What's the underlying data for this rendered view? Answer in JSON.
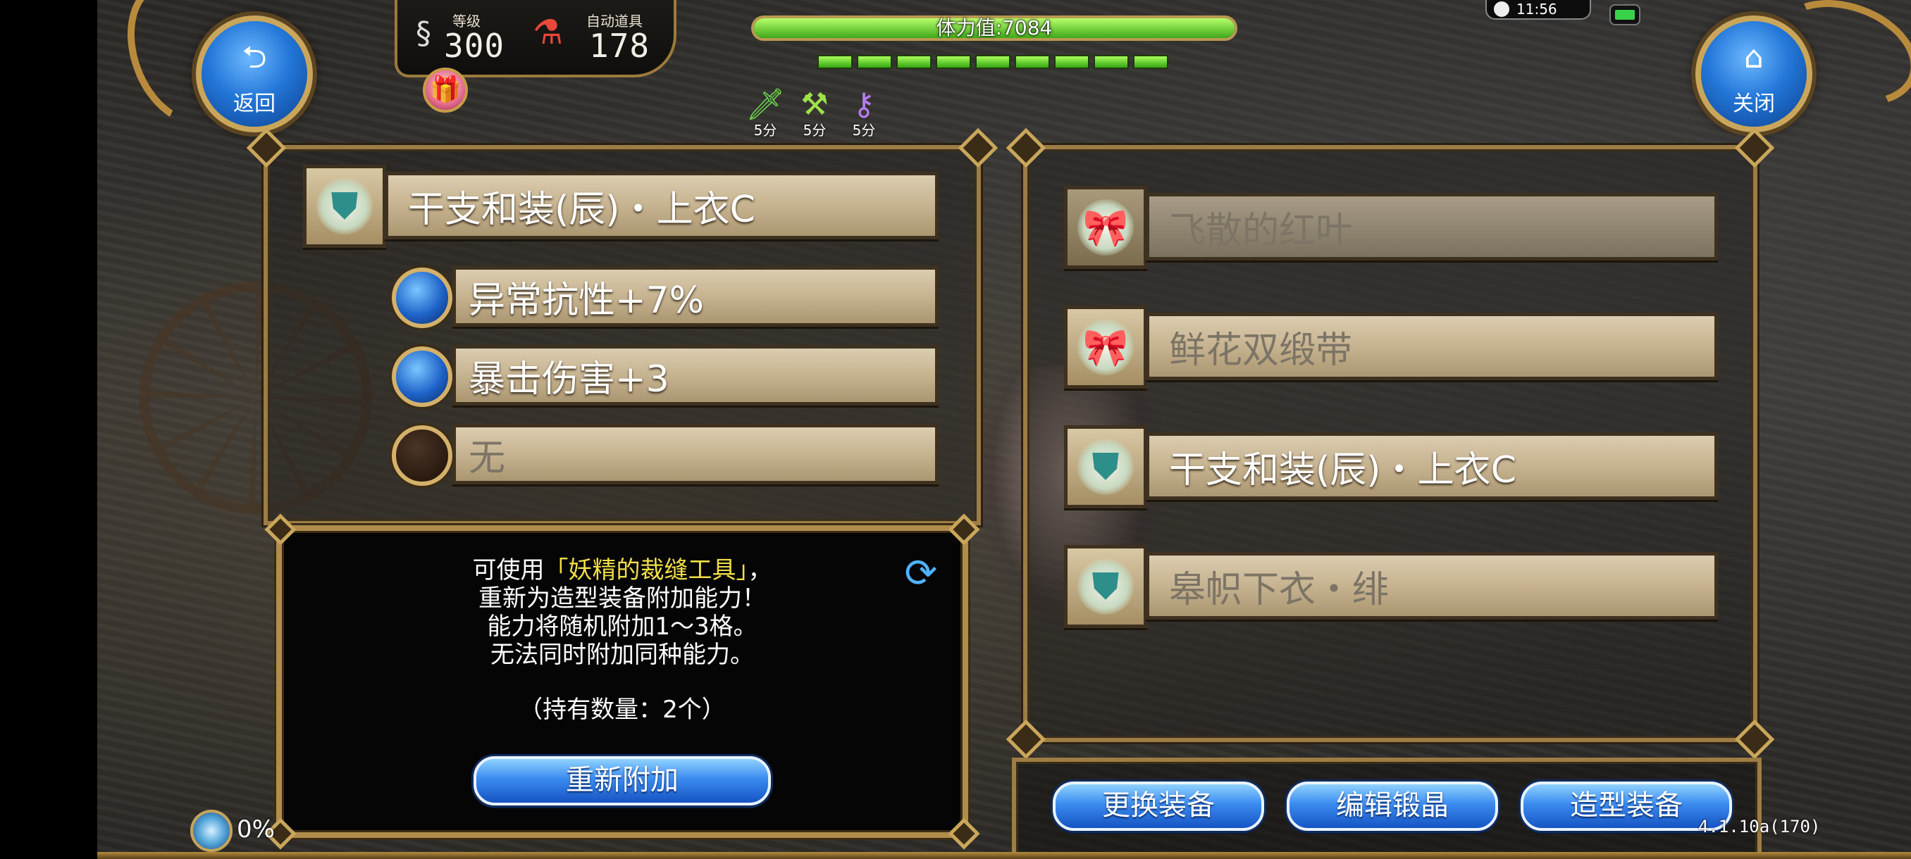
{
  "header": {
    "back_button": {
      "icon": "back-arrow-icon",
      "label": "返回"
    },
    "close_button": {
      "icon": "home-icon",
      "label": "关闭"
    },
    "level_label": "等级",
    "level_value": "300",
    "auto_item_label": "自动道具",
    "auto_item_value": "178",
    "stamina_text": "体力值:7084",
    "stamina_fraction": 1.0,
    "stamina_segments": 9,
    "buffs": [
      {
        "icon": "green-sword-icon",
        "text": "5分"
      },
      {
        "icon": "green-scythe-icon",
        "text": "5分"
      },
      {
        "icon": "purple-key-icon",
        "text": "5分"
      }
    ],
    "clock": "11:56"
  },
  "left": {
    "item_name": "干支和装(辰)・上衣C",
    "abilities": [
      {
        "label": "异常抗性+7%",
        "orb": "blue"
      },
      {
        "label": "暴击伤害+3",
        "orb": "blue"
      },
      {
        "label": "无",
        "orb": "empty"
      }
    ]
  },
  "info": {
    "line1_prefix": "可使用",
    "line1_highlight": "「妖精的裁缝工具」",
    "line1_suffix": "，",
    "line2": "重新为造型装备附加能力！",
    "line3": "能力将随机附加1～3格。",
    "line4": "无法同时附加同种能力。",
    "owned": "（持有数量：2个）",
    "reattach_button": "重新附加"
  },
  "right": {
    "items": [
      {
        "name": "飞散的红叶",
        "icon": "red-bow-icon",
        "active": false
      },
      {
        "name": "鲜花双缎带",
        "icon": "red-bow-icon",
        "active": false
      },
      {
        "name": "干支和装(辰)・上衣C",
        "icon": "armor-icon",
        "active": true
      },
      {
        "name": "皋帜下衣・绯",
        "icon": "armor-icon",
        "active": false
      }
    ]
  },
  "bottom_buttons": [
    "更换装备",
    "编辑锻晶",
    "造型装备"
  ],
  "footer": {
    "percent": "0%",
    "version": "4.1.10a(170)"
  },
  "colors": {
    "accent_gold": "#b08d4c",
    "button_blue": "#3b8bf0",
    "stamina_green": "#3fa81a",
    "highlight_yellow": "#f0df49"
  }
}
